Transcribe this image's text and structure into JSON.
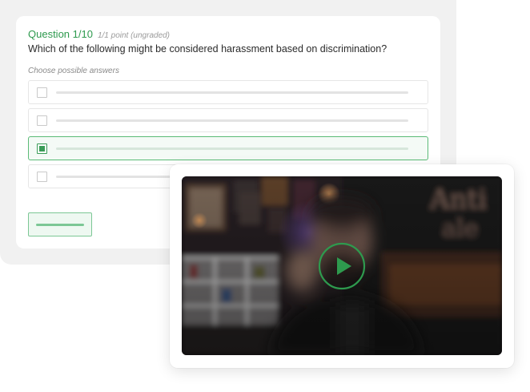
{
  "quiz": {
    "question_number": "Question 1/10",
    "points": "1/1 point (ungraded)",
    "question_text": "Which of the following might be considered harassment based on discrimination?",
    "hint": "Choose possible answers",
    "answers": [
      {
        "selected": false
      },
      {
        "selected": false
      },
      {
        "selected": true
      },
      {
        "selected": false
      }
    ]
  },
  "video": {
    "play_icon": "play-icon",
    "accent_color": "#2e9a4e"
  },
  "colors": {
    "accent": "#2e9a4e",
    "selected_border": "#5bbb77",
    "card_background": "#f1f1f1"
  }
}
